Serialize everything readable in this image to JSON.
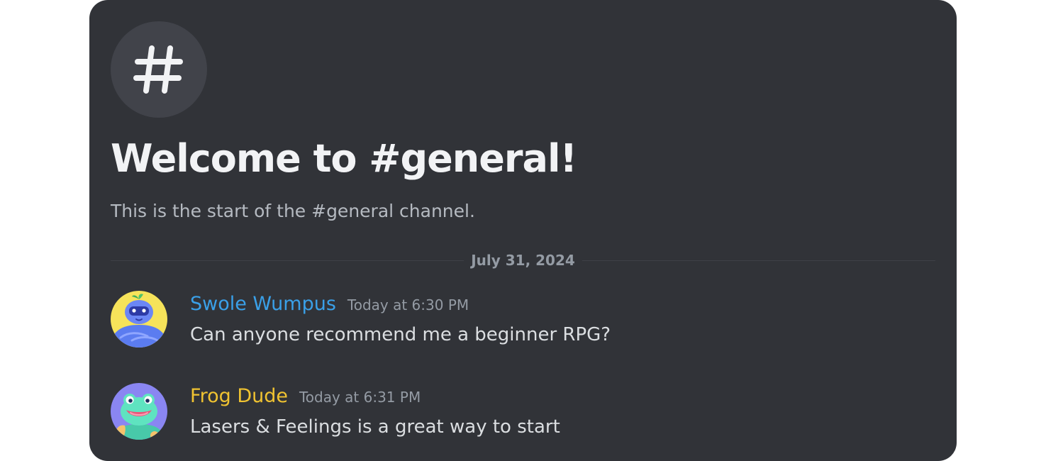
{
  "channel": {
    "icon": "hashtag-icon",
    "welcome_title": "Welcome to #general!",
    "welcome_subtitle": "This is the start of the #general channel."
  },
  "date_divider": "July 31, 2024",
  "messages": [
    {
      "author": "Swole Wumpus",
      "author_color": "#3aa0e8",
      "avatar": "wumpus-avatar-icon",
      "timestamp": "Today at 6:30 PM",
      "content": "Can anyone recommend me a beginner RPG?"
    },
    {
      "author": "Frog Dude",
      "author_color": "#f0c331",
      "avatar": "frog-avatar-icon",
      "timestamp": "Today at 6:31 PM",
      "content": "Lasers & Feelings is a great way to start"
    }
  ],
  "colors": {
    "background": "#313338",
    "channel_icon_bg": "#41434a",
    "title": "#f2f3f5",
    "subtitle": "#b5bac1",
    "muted": "#949ba4",
    "message_text": "#dbdee1"
  }
}
